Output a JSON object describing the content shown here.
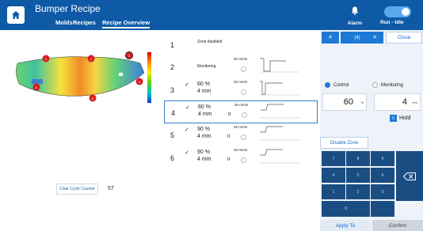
{
  "header": {
    "title": "Bumper Recipe",
    "tabs": [
      {
        "label": "Molds"
      },
      {
        "label": "Recipes"
      },
      {
        "label": "Recipe Overview"
      }
    ],
    "alarm_label": "Alarm",
    "run_label": "Run - Idle",
    "colors": {
      "bar": "#0e5aa7",
      "accent": "#1e78d6"
    }
  },
  "part": {
    "zone_markers": [
      "1",
      "2",
      "3",
      "4",
      "5",
      "6"
    ],
    "clear_button_label": "Clear Cycle Counter",
    "cycle_count": "57"
  },
  "zones": [
    {
      "num": "1",
      "text": "Zone disabled",
      "checked": false
    },
    {
      "num": "2",
      "text": "Monitoring",
      "speed": "50 mm/s",
      "checked": false
    },
    {
      "num": "3",
      "pct": "60 %",
      "dist": "4 mm",
      "speed": "30 mm/s",
      "checked": true
    },
    {
      "num": "4",
      "pct": "60 %",
      "dist": "4 mm",
      "speed": "30 mm/s",
      "pause": "II",
      "checked": true,
      "selected": true
    },
    {
      "num": "5",
      "pct": "90 %",
      "dist": "4 mm",
      "speed": "45 mm/s",
      "pause": "II",
      "checked": true
    },
    {
      "num": "6",
      "pct": "90 %",
      "dist": "4 mm",
      "speed": "45 mm/s",
      "pause": "II",
      "checked": true
    }
  ],
  "panel": {
    "prev": "<",
    "page": "(4)",
    "next": ">",
    "close": "Close",
    "control_label": "Control",
    "monitoring_label": "Monitoring",
    "control_value": "60",
    "control_unit": "%",
    "dist_value": "4",
    "dist_unit": "mm",
    "hold_label": "Hold",
    "disable_zone": "Disable Zone",
    "keys": [
      "7",
      "8",
      "9",
      "4",
      "5",
      "6",
      "1",
      "2",
      "3",
      "0",
      "."
    ],
    "apply": "Apply To",
    "confirm": "Confirm"
  }
}
